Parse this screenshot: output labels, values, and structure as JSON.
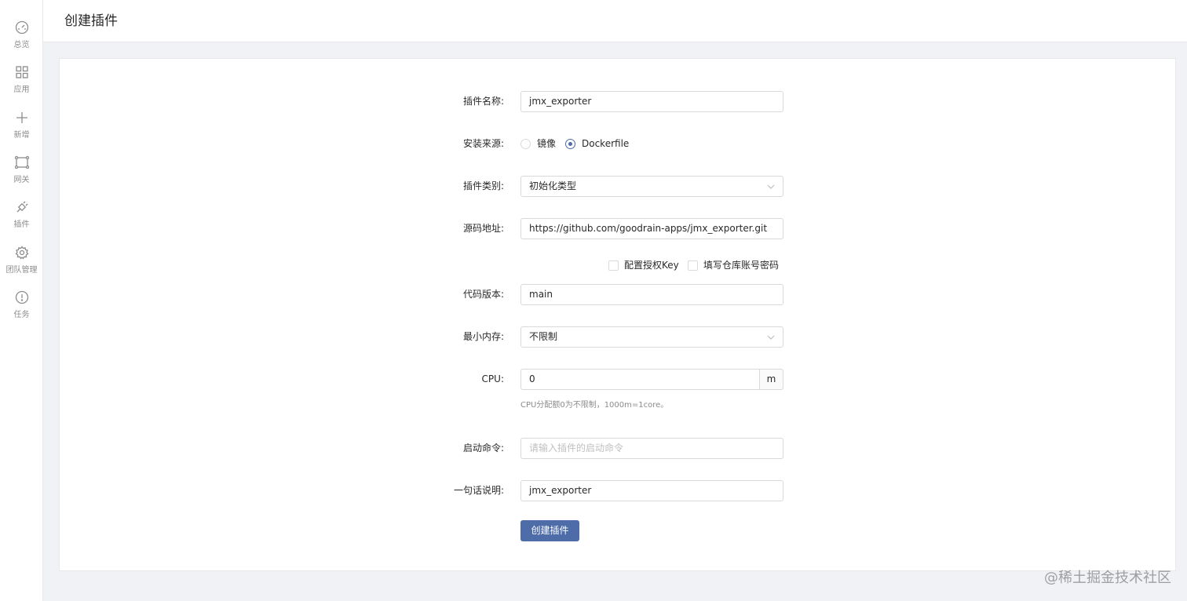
{
  "sidebar": {
    "items": [
      {
        "label": "总览",
        "icon": "dashboard-icon"
      },
      {
        "label": "应用",
        "icon": "apps-grid-icon"
      },
      {
        "label": "新增",
        "icon": "plus-icon"
      },
      {
        "label": "网关",
        "icon": "gateway-icon"
      },
      {
        "label": "插件",
        "icon": "plug-icon"
      },
      {
        "label": "团队管理",
        "icon": "gear-icon"
      },
      {
        "label": "任务",
        "icon": "alert-circle-icon"
      }
    ]
  },
  "header": {
    "title": "创建插件"
  },
  "form": {
    "name": {
      "label": "插件名称:",
      "value": "jmx_exporter"
    },
    "source": {
      "label": "安装来源:",
      "options": [
        "镜像",
        "Dockerfile"
      ],
      "selected": "Dockerfile"
    },
    "category": {
      "label": "插件类别:",
      "value": "初始化类型"
    },
    "repo": {
      "label": "源码地址:",
      "value": "https://github.com/goodrain-apps/jmx_exporter.git"
    },
    "repo_options": {
      "auth_key": "配置授权Key",
      "account": "填写仓库账号密码"
    },
    "version": {
      "label": "代码版本:",
      "value": "main"
    },
    "memory": {
      "label": "最小内存:",
      "value": "不限制"
    },
    "cpu": {
      "label": "CPU:",
      "value": "0",
      "unit": "m",
      "hint": "CPU分配额0为不限制，1000m=1core。"
    },
    "command": {
      "label": "启动命令:",
      "placeholder": "请输入插件的启动命令"
    },
    "desc": {
      "label": "一句话说明:",
      "value": "jmx_exporter"
    },
    "submit_label": "创建插件"
  },
  "watermark": "@稀土掘金技术社区",
  "colors": {
    "primary": "#4d6ca8",
    "background": "#f0f2f5"
  }
}
